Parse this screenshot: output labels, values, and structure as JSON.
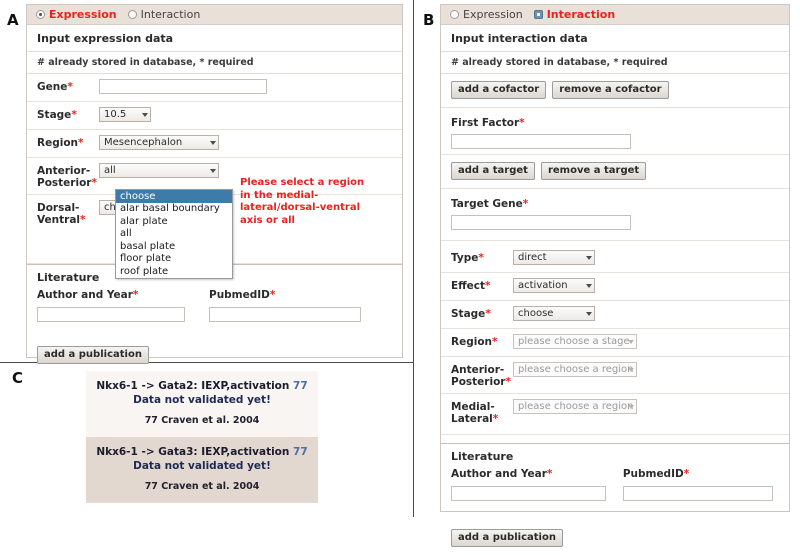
{
  "figure": {
    "panel_letters": {
      "a": "A",
      "b": "B",
      "c": "C"
    }
  },
  "panel_a": {
    "mode": {
      "expression_label": "Expression",
      "interaction_label": "Interaction",
      "selected": "Expression"
    },
    "section_title": "Input expression data",
    "legend": "# already stored in database, * required",
    "fields": {
      "gene_label": "Gene",
      "gene_value": "",
      "stage_label": "Stage",
      "stage_value": "10.5",
      "region_label": "Region",
      "region_value": "Mesencephalon",
      "ap_label": "Anterior-Posterior",
      "ap_value": "all",
      "dv_label": "Dorsal-Ventral",
      "dv_value": "choose"
    },
    "dropdown_open": {
      "options": [
        "choose",
        "alar basal boundary",
        "alar plate",
        "all",
        "basal plate",
        "floor plate",
        "roof plate"
      ],
      "selected": "choose"
    },
    "hint": "Please select a region in the medial-lateral/dorsal-ventral axis or all",
    "literature": {
      "title": "Literature",
      "author_label": "Author and Year",
      "author_value": "",
      "pubmed_label": "PubmedID",
      "pubmed_value": "",
      "add_button": "add a publication"
    }
  },
  "panel_b": {
    "mode": {
      "expression_label": "Expression",
      "interaction_label": "Interaction",
      "selected": "Interaction"
    },
    "section_title": "Input interaction data",
    "legend": "# already stored in database, * required",
    "cofactor_buttons": {
      "add": "add a cofactor",
      "remove": "remove a cofactor"
    },
    "first_factor_label": "First Factor",
    "first_factor_value": "",
    "target_buttons": {
      "add": "add a target",
      "remove": "remove a target"
    },
    "target_gene_label": "Target Gene",
    "target_gene_value": "",
    "fields": {
      "type_label": "Type",
      "type_value": "direct",
      "effect_label": "Effect",
      "effect_value": "activation",
      "stage_label": "Stage",
      "stage_value": "choose",
      "region_label": "Region",
      "region_value": "please choose a stage",
      "ap_label": "Anterior-Posterior",
      "ap_value": "please choose a region",
      "ml_label": "Medial-Lateral",
      "ml_value": "please choose a region"
    },
    "literature": {
      "title": "Literature",
      "author_label": "Author and Year",
      "author_value": "",
      "pubmed_label": "PubmedID",
      "pubmed_value": "",
      "add_button": "add a publication"
    }
  },
  "panel_c": {
    "rows": [
      {
        "interaction": "Nkx6-1 -> Gata2: IEXP,activation",
        "ref_number": "77",
        "status": "Data not validated yet!",
        "citation": "77 Craven et al. 2004"
      },
      {
        "interaction": "Nkx6-1 -> Gata3: IEXP,activation",
        "ref_number": "77",
        "status": "Data not validated yet!",
        "citation": "77 Craven et al. 2004"
      }
    ]
  },
  "colors": {
    "required_red": "#e8231f",
    "mode_bar_bg": "#eae0da",
    "dropdown_highlight": "#3d7ca8",
    "link_blue": "#4a6fa5",
    "panel_c_alt_bg": "#e2d8d0"
  }
}
